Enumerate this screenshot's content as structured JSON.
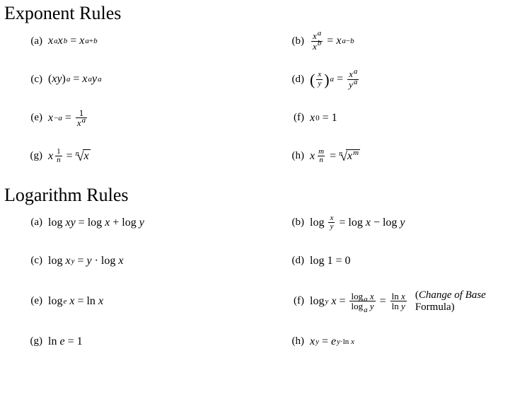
{
  "sections": {
    "exponent": {
      "title": "Exponent Rules",
      "items": {
        "a": {
          "label": "(a)"
        },
        "b": {
          "label": "(b)"
        },
        "c": {
          "label": "(c)"
        },
        "d": {
          "label": "(d)"
        },
        "e": {
          "label": "(e)"
        },
        "f": {
          "label": "(f)"
        },
        "g": {
          "label": "(g)"
        },
        "h": {
          "label": "(h)"
        }
      }
    },
    "logarithm": {
      "title": "Logarithm Rules",
      "items": {
        "a": {
          "label": "(a)"
        },
        "b": {
          "label": "(b)"
        },
        "c": {
          "label": "(c)"
        },
        "d": {
          "label": "(d)"
        },
        "e": {
          "label": "(e)"
        },
        "f": {
          "label": "(f)",
          "annotation_it": "Change of Base",
          "annotation_rm": " Formula"
        },
        "g": {
          "label": "(g)"
        },
        "h": {
          "label": "(h)"
        }
      }
    }
  },
  "sym": {
    "x": "x",
    "y": "y",
    "a": "a",
    "b": "b",
    "m": "m",
    "n": "n",
    "e": "e",
    "eq": "=",
    "plus": "+",
    "minus": "−",
    "cdot": "·",
    "one": "1",
    "zero": "0",
    "log": "log",
    "ln": "ln",
    "lparen": "(",
    "rparen": ")"
  }
}
